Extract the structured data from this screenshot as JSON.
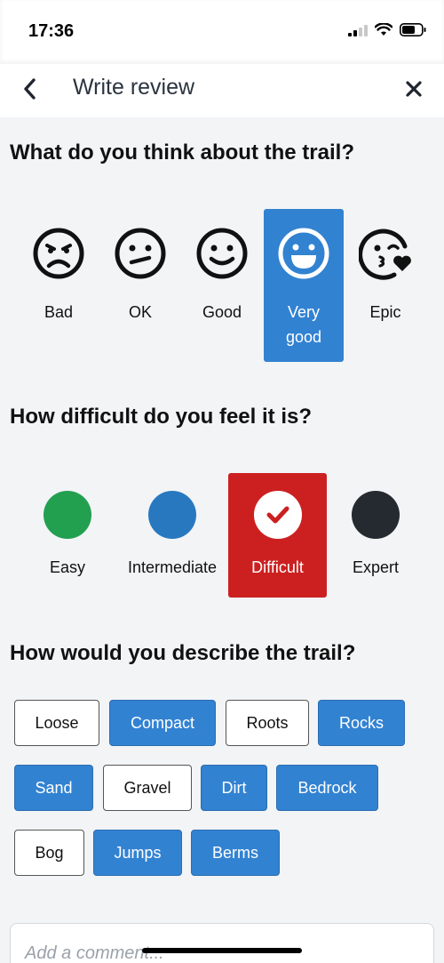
{
  "status": {
    "time": "17:36"
  },
  "header": {
    "title": "Write review"
  },
  "rating": {
    "question": "What do you think about the trail?",
    "options": [
      {
        "label": "Bad"
      },
      {
        "label": "OK"
      },
      {
        "label": "Good"
      },
      {
        "label": "Very good"
      },
      {
        "label": "Epic"
      }
    ],
    "selected": "Very good",
    "selected_color": "#3282d2"
  },
  "difficulty": {
    "question": "How difficult do you feel it is?",
    "options": [
      {
        "label": "Easy",
        "color": "#22a050"
      },
      {
        "label": "Intermediate",
        "color": "#2878c0"
      },
      {
        "label": "Difficult",
        "color": "#cc2020"
      },
      {
        "label": "Expert",
        "color": "#252a30"
      }
    ],
    "selected": "Difficult"
  },
  "description": {
    "question": "How would you describe the trail?",
    "tags": [
      {
        "label": "Loose",
        "selected": false
      },
      {
        "label": "Compact",
        "selected": true
      },
      {
        "label": "Roots",
        "selected": false
      },
      {
        "label": "Rocks",
        "selected": true
      },
      {
        "label": "Sand",
        "selected": true
      },
      {
        "label": "Gravel",
        "selected": false
      },
      {
        "label": "Dirt",
        "selected": true
      },
      {
        "label": "Bedrock",
        "selected": true
      },
      {
        "label": "Bog",
        "selected": false
      },
      {
        "label": "Jumps",
        "selected": true
      },
      {
        "label": "Berms",
        "selected": true
      }
    ]
  },
  "comment": {
    "placeholder": "Add a comment..."
  },
  "icons": {
    "back": "chevron-left-icon",
    "close": "close-icon",
    "signal": "signal-icon",
    "wifi": "wifi-icon",
    "battery": "battery-icon"
  }
}
